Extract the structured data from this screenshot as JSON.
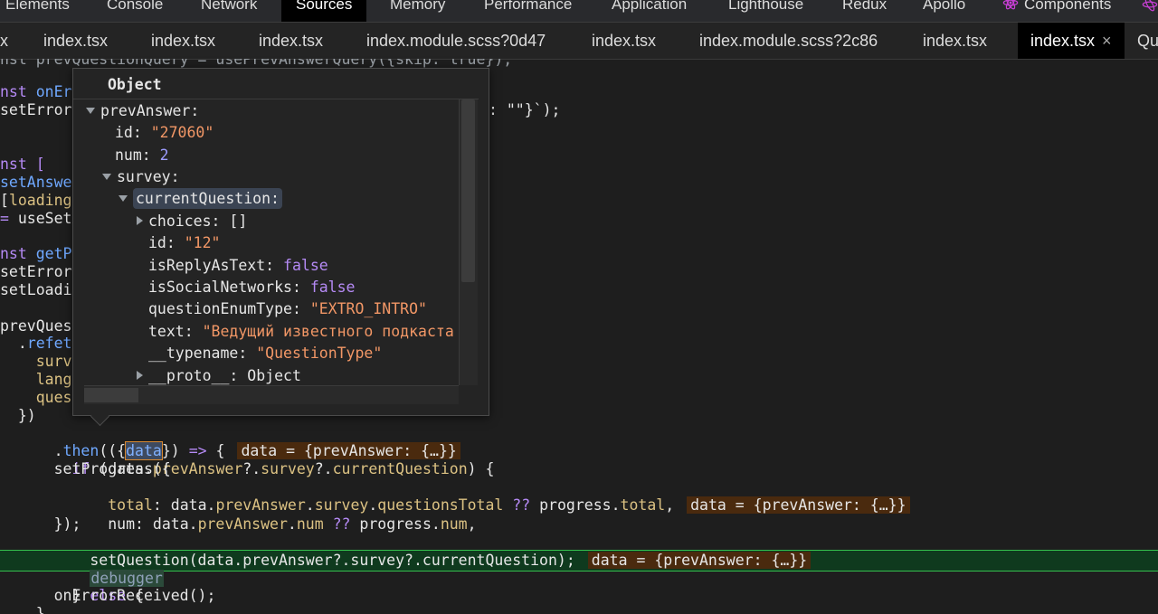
{
  "topbar": {
    "tabs": [
      "Elements",
      "Console",
      "Network",
      "Sources",
      "Memory",
      "Performance",
      "Application",
      "Lighthouse",
      "Redux",
      "Apollo",
      "Components"
    ],
    "active": "Sources"
  },
  "files": {
    "tabs": [
      "x",
      "index.tsx",
      "index.tsx",
      "index.tsx",
      "index.module.scss?0d47",
      "index.tsx",
      "index.module.scss?2c86",
      "index.tsx",
      "index.tsx",
      "Qu"
    ],
    "active_index": 8,
    "close_glyph": "×"
  },
  "code": {
    "l0": "nst prevQuestionQuery = usePrevAnswerQuery({skip: true});",
    "l1a": "nst ",
    "l1b": "onErr",
    "l2a": "setError(",
    "l2b": ": \"\"}`);",
    "l3": "nst [",
    "l4": "setAnswer",
    "l5a": "[",
    "l5b": "loading:",
    "l6a": "= ",
    "l6b": "useSetA",
    "l7a": "nst ",
    "l7b": "getPr",
    "l8": "setError(",
    "l9": "setLoadin",
    "l10": "prevQuest",
    "l11a": "  .",
    "l11b": "refetc",
    "l12": "    surve",
    "l13": "    lang,",
    "l14": "    quest",
    "l15": "  })",
    "l16a": "  .",
    "l16b": "then",
    "l16c": "(({",
    "l16d": "data",
    "l16e": "}) ",
    "l16f": "=>",
    "l16g": " {",
    "l16v": "data = {prevAnswer: {…}}",
    "l17a": "    ",
    "l17b": "if",
    "l17c": " (data.",
    "l17d": "prevAnswer",
    "l17e": "?.",
    "l17f": "survey",
    "l17g": "?.",
    "l17h": "currentQuestion",
    "l17i": ") {",
    "l18": "      setProgress({",
    "l19a": "        ",
    "l19b": "total",
    "l19c": ": data.",
    "l19d": "prevAnswer",
    "l19e": ".",
    "l19f": "survey",
    "l19g": ".",
    "l19h": "questionsTotal",
    "l19i": " ?? ",
    "l19j": "progress.",
    "l19k": "total",
    "l19l": ",",
    "l19v": "data = {prevAnswer: {…}}",
    "l20a": "        num: data.",
    "l20b": "prevAnswer",
    "l20c": ".",
    "l20d": "num",
    "l20e": " ?? ",
    "l20f": "progress.",
    "l20g": "num",
    "l20h": ",",
    "l21": "      });",
    "l22": "      setQuestion(data.prevAnswer?.survey?.currentQuestion);",
    "l22v": "data = {prevAnswer: {…}}",
    "l23a": "      ",
    "l23b": "debugger",
    "l24a": "    } ",
    "l24b": "else",
    "l24c": " {",
    "l25": "      onErrorReceived();",
    "l26": "    }"
  },
  "popover": {
    "title": "Object",
    "rows": {
      "prevAnswer": "prevAnswer:",
      "id_key": "id: ",
      "id_val": "\"27060\"",
      "num_key": "num: ",
      "num_val": "2",
      "survey": "survey:",
      "cq": "currentQuestion:",
      "choices": "choices: []",
      "id2_key": "id: ",
      "id2_val": "\"12\"",
      "reply_key": "isReplyAsText: ",
      "reply_val": "false",
      "social_key": "isSocialNetworks: ",
      "social_val": "false",
      "qet_key": "questionEnumType: ",
      "qet_val": "\"EXTRO_INTRO\"",
      "text_key": "text: ",
      "text_val": "\"Ведущий известного подкаста",
      "tn_key": "__typename: ",
      "tn_val": "\"QuestionType\"",
      "proto": "__proto__: Object"
    }
  },
  "colors": {
    "accent_exec": "#35c04e",
    "inline_value_bg": "#4a2a0e"
  }
}
